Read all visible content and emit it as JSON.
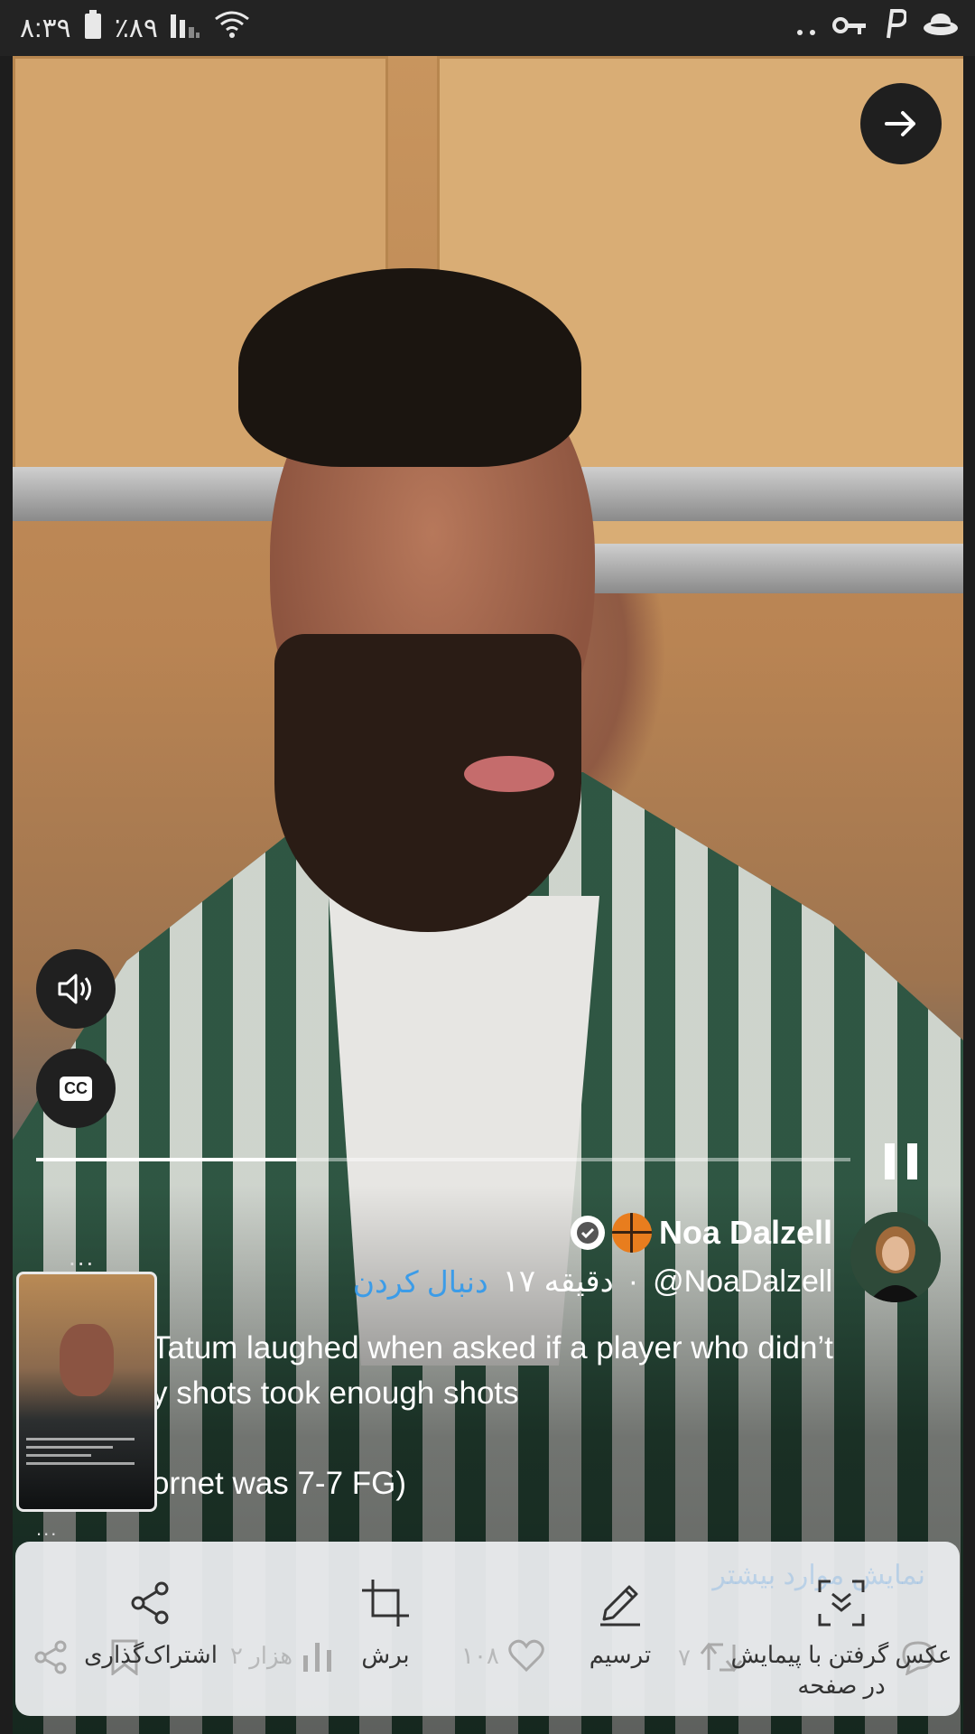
{
  "status_bar": {
    "time": "۸:۳۹",
    "battery": "٪۸۹"
  },
  "tweet": {
    "author_name": "Noa Dalzell",
    "handle": "@NoaDalzell",
    "time_ago": "۱۷ دقیقه",
    "separator": "·",
    "follow_label": "دنبال کردن",
    "text_lines": [
      "Tatum laughed when asked if a player who didn’t",
      "y shots took enough shots",
      "",
      "ornet was 7-7 FG)"
    ]
  },
  "video": {
    "progress": 0.32
  },
  "overflow": {
    "top": "...",
    "bottom": "..."
  },
  "sheet": {
    "show_more": "نمایش موارد بیشتر",
    "actions": {
      "share": "اشتراک‌گذاری",
      "crop": "برش",
      "draw": "ترسیم",
      "scroll_capture_line1": "عکس گرفتن با پیمایش",
      "scroll_capture_line2": "در صفحه"
    }
  },
  "tweet_stats": {
    "views": "۲ هزار",
    "likes": "۱۰۸",
    "retweets": "۷"
  }
}
